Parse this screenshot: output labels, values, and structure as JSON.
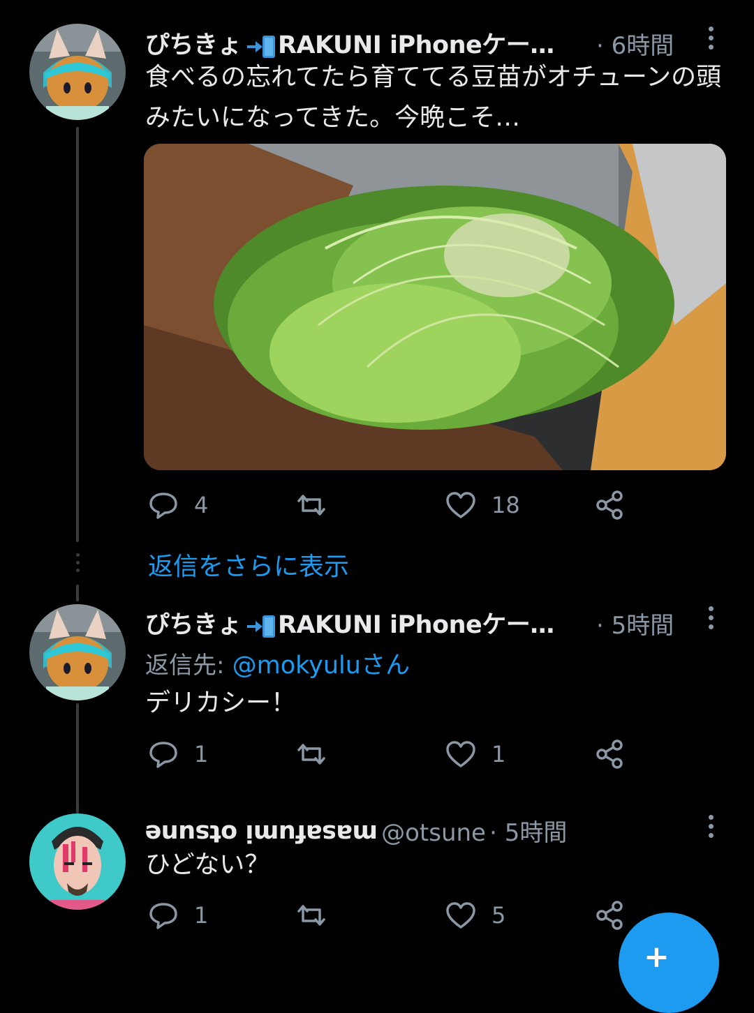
{
  "tweets": [
    {
      "author": "ぴちきょ",
      "author_suffix": "RAKUNI iPhoneケー…",
      "time": "· 6時間",
      "text": "食べるの忘れてたら育ててる豆苗がオチューンの頭みたいになってきた。今晩こそ…",
      "media_icon": "plant-photo",
      "replies": "4",
      "retweets": "",
      "likes": "18"
    },
    {
      "author": "ぴちきょ",
      "author_suffix": "RAKUNI iPhoneケー…",
      "time": "· 5時間",
      "reply_to_label": "返信先:",
      "reply_to_handle": "@mokyuluさん",
      "text": "デリカシー！",
      "replies": "1",
      "retweets": "",
      "likes": "1"
    },
    {
      "author": "masafumi otsune",
      "handle": "@otsune",
      "time": "· 5時間",
      "text": "ひどない？",
      "replies": "1",
      "retweets": "",
      "likes": "5"
    }
  ],
  "show_more_replies": "返信をさらに表示",
  "fab_label": "+",
  "icons": [
    "reply-icon",
    "retweet-icon",
    "like-icon",
    "share-icon",
    "more-icon",
    "door-badge-icon",
    "compose-icon"
  ],
  "colors": {
    "background": "#000000",
    "accent": "#1d9bf0",
    "secondary_text": "#8b98a5",
    "primary_text": "#e7e9ea"
  }
}
